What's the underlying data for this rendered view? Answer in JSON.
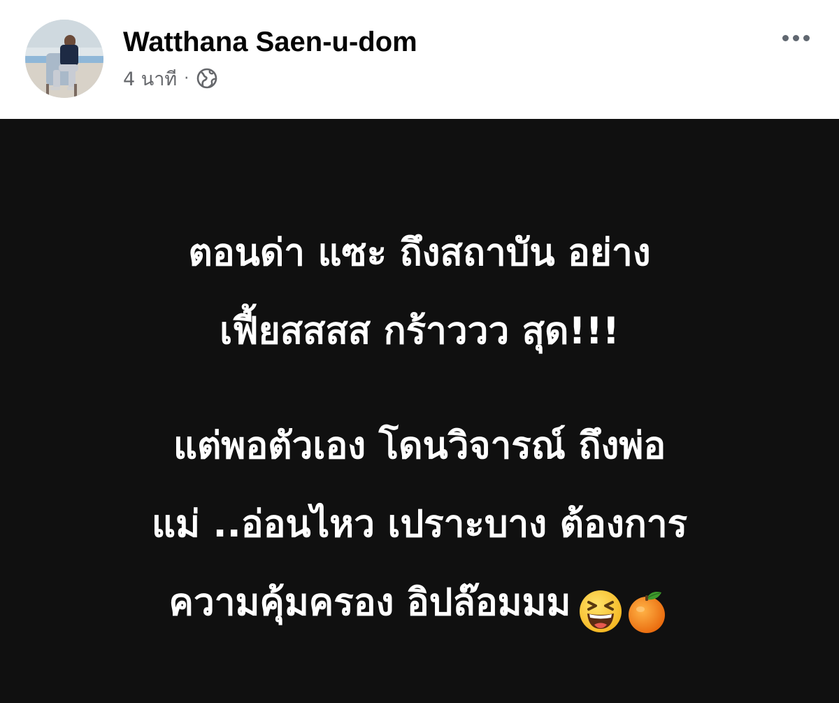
{
  "post": {
    "author": {
      "name": "Watthana Saen-u-dom"
    },
    "meta": {
      "time": "4 นาที",
      "separator": "·",
      "audience_icon": "globe-icon"
    },
    "more_icon": "more-options-icon",
    "background_color": "#101010",
    "text_color": "#ffffff",
    "content": {
      "paragraph_1": {
        "line_1": "ตอนด่า แซะ ถึงสถาบัน อย่าง",
        "line_2": "เฟี้ยสสสส กร้าววว สุด!!!"
      },
      "paragraph_2": {
        "line_1": "แต่พอตัวเอง โดนวิจารณ์ ถึงพ่อ",
        "line_2": "แม่ ..อ่อนไหว เปราะบาง ต้องการ",
        "line_3": "ความคุ้มครอง อิปล๊อมมม"
      },
      "emojis": [
        "laughing-face-emoji",
        "tangerine-emoji"
      ]
    }
  }
}
